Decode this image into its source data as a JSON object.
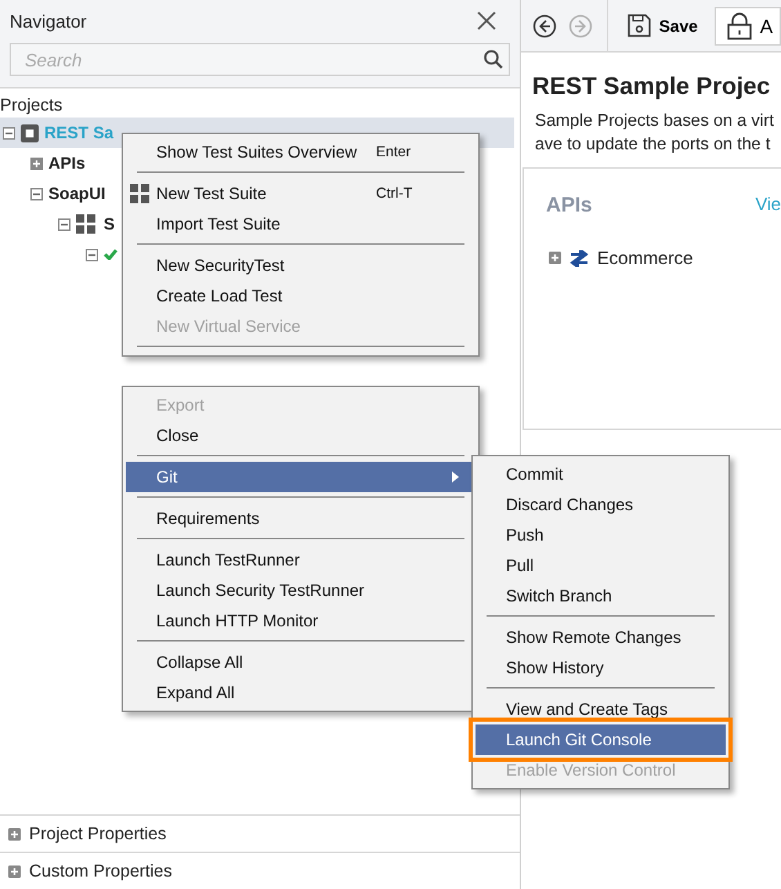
{
  "navigator": {
    "title": "Navigator",
    "search": {
      "placeholder": "Search"
    },
    "section_label": "Projects",
    "tree": [
      {
        "label": "REST Sa",
        "kind": "project",
        "expanded": true,
        "selected": true,
        "children": [
          {
            "label": "APIs",
            "expanded": false,
            "selected": false
          },
          {
            "label": "SoapUI",
            "expanded": true,
            "selected": false,
            "children": [
              {
                "label": "S",
                "kind": "suite",
                "expanded": true,
                "selected": false,
                "children": [
                  {
                    "kind": "check",
                    "expanded": true,
                    "selected": false
                  }
                ]
              }
            ]
          }
        ]
      }
    ],
    "properties": [
      {
        "label": "Project Properties",
        "expanded": false
      },
      {
        "label": "Custom Properties",
        "expanded": false
      }
    ]
  },
  "toolbar": {
    "buttons": [
      {
        "kind": "back",
        "disabled": false
      },
      {
        "kind": "forward",
        "disabled": true
      },
      {
        "kind": "save",
        "label": "Save"
      },
      {
        "kind": "lock",
        "label": "A"
      }
    ]
  },
  "project": {
    "title": "REST Sample Projec",
    "description": [
      "Sample Projects bases on a virt",
      "ave to update the ports on the t"
    ],
    "apis": {
      "heading": "APIs",
      "link": "Vie",
      "items": [
        {
          "label": "Ecommerce",
          "expanded": false
        }
      ]
    }
  },
  "context_menu": {
    "sections": [
      [
        {
          "kind": "item",
          "label": "Show Test Suites Overview",
          "shortcut": "Enter",
          "disabled": false,
          "selected": false
        },
        {
          "kind": "separator"
        },
        {
          "kind": "grid_item",
          "label": "New Test Suite",
          "shortcut": "Ctrl-T",
          "disabled": false,
          "selected": false
        },
        {
          "kind": "item",
          "label": "Import Test Suite",
          "disabled": false,
          "selected": false
        },
        {
          "kind": "separator"
        },
        {
          "kind": "item",
          "label": "New SecurityTest",
          "disabled": false,
          "selected": false
        },
        {
          "kind": "item",
          "label": "Create Load Test",
          "disabled": false,
          "selected": false
        },
        {
          "kind": "item",
          "label": "New Virtual Service",
          "disabled": true,
          "selected": false
        },
        {
          "kind": "separator"
        }
      ],
      [
        {
          "kind": "item",
          "label": "Export",
          "disabled": true,
          "selected": false
        },
        {
          "kind": "item",
          "label": "Close",
          "disabled": false,
          "selected": false
        },
        {
          "kind": "separator"
        },
        {
          "kind": "item",
          "label": "Git",
          "disabled": false,
          "selected": true,
          "submenu": true
        },
        {
          "kind": "separator"
        },
        {
          "kind": "item",
          "label": "Requirements",
          "disabled": false,
          "selected": false
        },
        {
          "kind": "separator"
        },
        {
          "kind": "item",
          "label": "Launch TestRunner",
          "disabled": false,
          "selected": false
        },
        {
          "kind": "item",
          "label": "Launch Security TestRunner",
          "disabled": false,
          "selected": false
        },
        {
          "kind": "item",
          "label": "Launch HTTP Monitor",
          "disabled": false,
          "selected": false
        },
        {
          "kind": "separator"
        },
        {
          "kind": "item",
          "label": "Collapse All",
          "disabled": false,
          "selected": false
        },
        {
          "kind": "item",
          "label": "Expand All",
          "disabled": false,
          "selected": false
        }
      ]
    ]
  },
  "git_submenu": {
    "items": [
      {
        "kind": "item",
        "label": "Commit",
        "disabled": false,
        "selected": false
      },
      {
        "kind": "item",
        "label": "Discard Changes",
        "disabled": false,
        "selected": false
      },
      {
        "kind": "item",
        "label": "Push",
        "disabled": false,
        "selected": false
      },
      {
        "kind": "item",
        "label": "Pull",
        "disabled": false,
        "selected": false
      },
      {
        "kind": "item",
        "label": "Switch Branch",
        "disabled": false,
        "selected": false
      },
      {
        "kind": "separator"
      },
      {
        "kind": "item",
        "label": "Show Remote Changes",
        "disabled": false,
        "selected": false
      },
      {
        "kind": "item",
        "label": "Show History",
        "disabled": false,
        "selected": false
      },
      {
        "kind": "separator"
      },
      {
        "kind": "item",
        "label": "View and Create Tags",
        "disabled": false,
        "selected": false
      },
      {
        "kind": "item",
        "label": "Launch Git Console",
        "disabled": false,
        "selected": true,
        "callout": true
      },
      {
        "kind": "item",
        "label": "Enable Version Control",
        "disabled": true,
        "selected": false
      }
    ]
  }
}
